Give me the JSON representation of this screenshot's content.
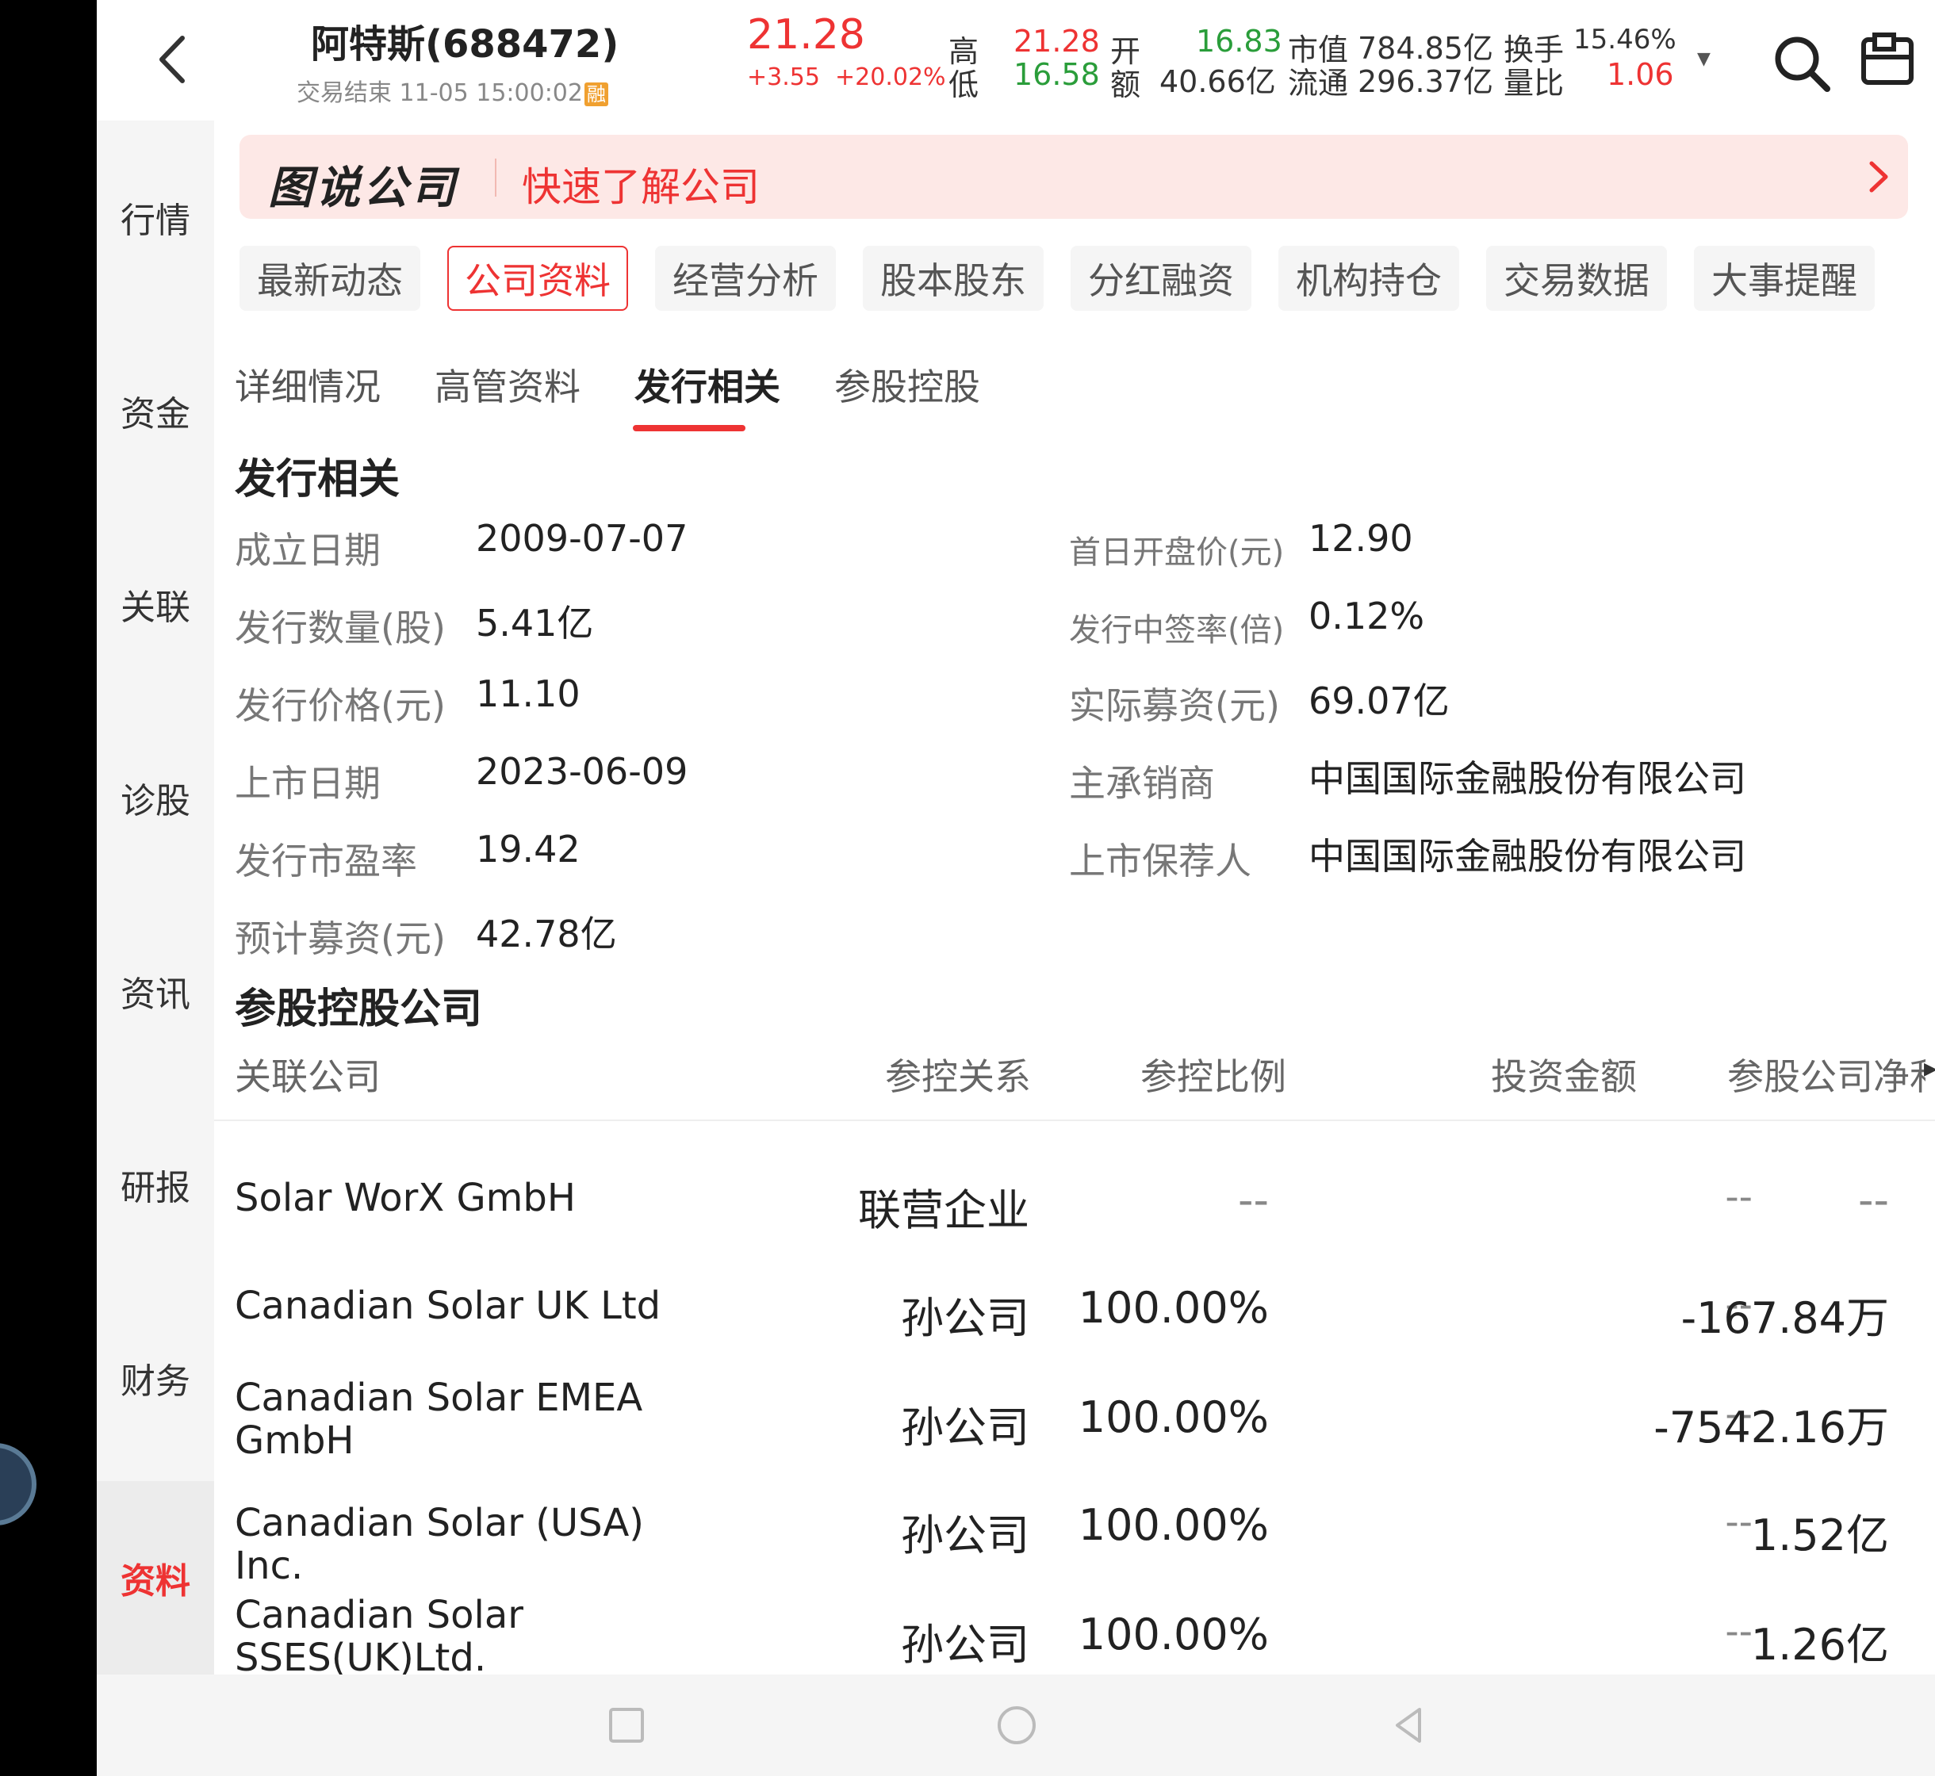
{
  "header": {
    "stock_name": "阿特斯(688472)",
    "status": "交易结束 11-05 15:00:02",
    "rong_badge": "融",
    "price": "21.28",
    "change_abs": "+3.55",
    "change_pct": "+20.02%",
    "high_label": "高",
    "high": "21.28",
    "low_label": "低",
    "low": "16.58",
    "open_label": "开",
    "open": "16.83",
    "amount_label": "额",
    "amount": "40.66亿",
    "mcap_label": "市值",
    "mcap": "784.85亿",
    "float_label": "流通",
    "float_cap": "296.37亿",
    "turnover_label": "换手",
    "turnover": "15.46%",
    "vol_ratio_label": "量比",
    "vol_ratio": "1.06"
  },
  "leftnav": [
    "行情",
    "资金",
    "关联",
    "诊股",
    "资讯",
    "研报",
    "财务",
    "资料"
  ],
  "banner": {
    "logo": "图说公司",
    "text": "快速了解公司"
  },
  "tabs": [
    "最新动态",
    "公司资料",
    "经营分析",
    "股本股东",
    "分红融资",
    "机构持仓",
    "交易数据",
    "大事提醒"
  ],
  "subtabs": [
    "详细情况",
    "高管资料",
    "发行相关",
    "参股控股"
  ],
  "issue": {
    "title": "发行相关",
    "left": [
      {
        "label": "成立日期",
        "value": "2009-07-07"
      },
      {
        "label": "发行数量(股)",
        "value": "5.41亿"
      },
      {
        "label": "发行价格(元)",
        "value": "11.10"
      },
      {
        "label": "上市日期",
        "value": "2023-06-09"
      },
      {
        "label": "发行市盈率",
        "value": "19.42"
      },
      {
        "label": "预计募资(元)",
        "value": "42.78亿"
      }
    ],
    "right": [
      {
        "label": "首日开盘价(元)",
        "value": "12.90"
      },
      {
        "label": "发行中签率(倍)",
        "value": "0.12%"
      },
      {
        "label": "实际募资(元)",
        "value": "69.07亿"
      },
      {
        "label": "主承销商",
        "value": "中国国际金融股份有限公司"
      },
      {
        "label": "上市保荐人",
        "value": "中国国际金融股份有限公司"
      }
    ]
  },
  "holdings": {
    "title": "参股控股公司",
    "columns": [
      "关联公司",
      "参控关系",
      "参控比例",
      "投资金额",
      "参股公司净利润"
    ],
    "rows": [
      {
        "name": "Solar WorX GmbH",
        "relation": "联营企业",
        "ratio": "--",
        "amount": "--",
        "profit": "--"
      },
      {
        "name": "Canadian Solar UK Ltd",
        "relation": "孙公司",
        "ratio": "100.00%",
        "amount": "--",
        "profit": "-167.84万"
      },
      {
        "name": "Canadian Solar EMEA GmbH",
        "relation": "孙公司",
        "ratio": "100.00%",
        "amount": "--",
        "profit": "-7542.16万"
      },
      {
        "name": "Canadian Solar (USA) Inc.",
        "relation": "孙公司",
        "ratio": "100.00%",
        "amount": "--",
        "profit": "1.52亿"
      },
      {
        "name": "Canadian Solar SSES(UK)Ltd.",
        "relation": "孙公司",
        "ratio": "100.00%",
        "amount": "--",
        "profit": "1.26亿"
      }
    ]
  },
  "colors": {
    "accent": "#e33333",
    "up": "#e33333",
    "down": "#2a9d3a",
    "banner_bg": "#fde8e6"
  }
}
